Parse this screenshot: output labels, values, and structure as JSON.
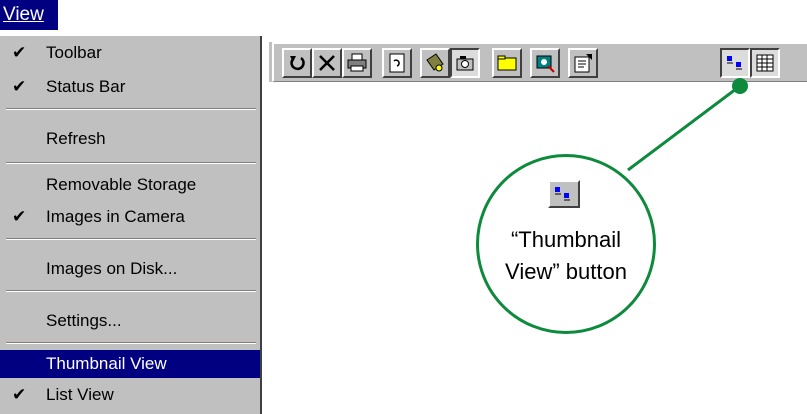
{
  "menubar": {
    "view_label": "View"
  },
  "menu": {
    "items": [
      {
        "label": "Toolbar",
        "checked": true
      },
      {
        "label": "Status Bar",
        "checked": true
      },
      {
        "label": "Refresh",
        "checked": false
      },
      {
        "label": "Removable Storage",
        "checked": false
      },
      {
        "label": "Images in Camera",
        "checked": true
      },
      {
        "label": "Images on Disk...",
        "checked": false
      },
      {
        "label": "Settings...",
        "checked": false
      },
      {
        "label": "Thumbnail View",
        "checked": false,
        "selected": true
      },
      {
        "label": "List View",
        "checked": true
      }
    ],
    "check_glyph": "✔"
  },
  "toolbar": {
    "buttons": [
      {
        "icon": "undo-icon"
      },
      {
        "icon": "delete-icon"
      },
      {
        "icon": "print-icon"
      },
      {
        "icon": "rotate-icon"
      },
      {
        "icon": "transfer-icon"
      },
      {
        "icon": "camera-icon"
      },
      {
        "icon": "folder-icon"
      },
      {
        "icon": "camera-settings-icon"
      },
      {
        "icon": "properties-icon"
      },
      {
        "icon": "thumbnail-view-icon",
        "pressed": true
      },
      {
        "icon": "list-view-icon",
        "pressed": true
      }
    ]
  },
  "callout": {
    "text_line1": "“Thumbnail",
    "text_line2": "View” button",
    "color": "#0d8a3c"
  },
  "colors": {
    "menu_bg": "#c0c0c0",
    "selection": "#000080",
    "callout": "#0d8a3c"
  }
}
